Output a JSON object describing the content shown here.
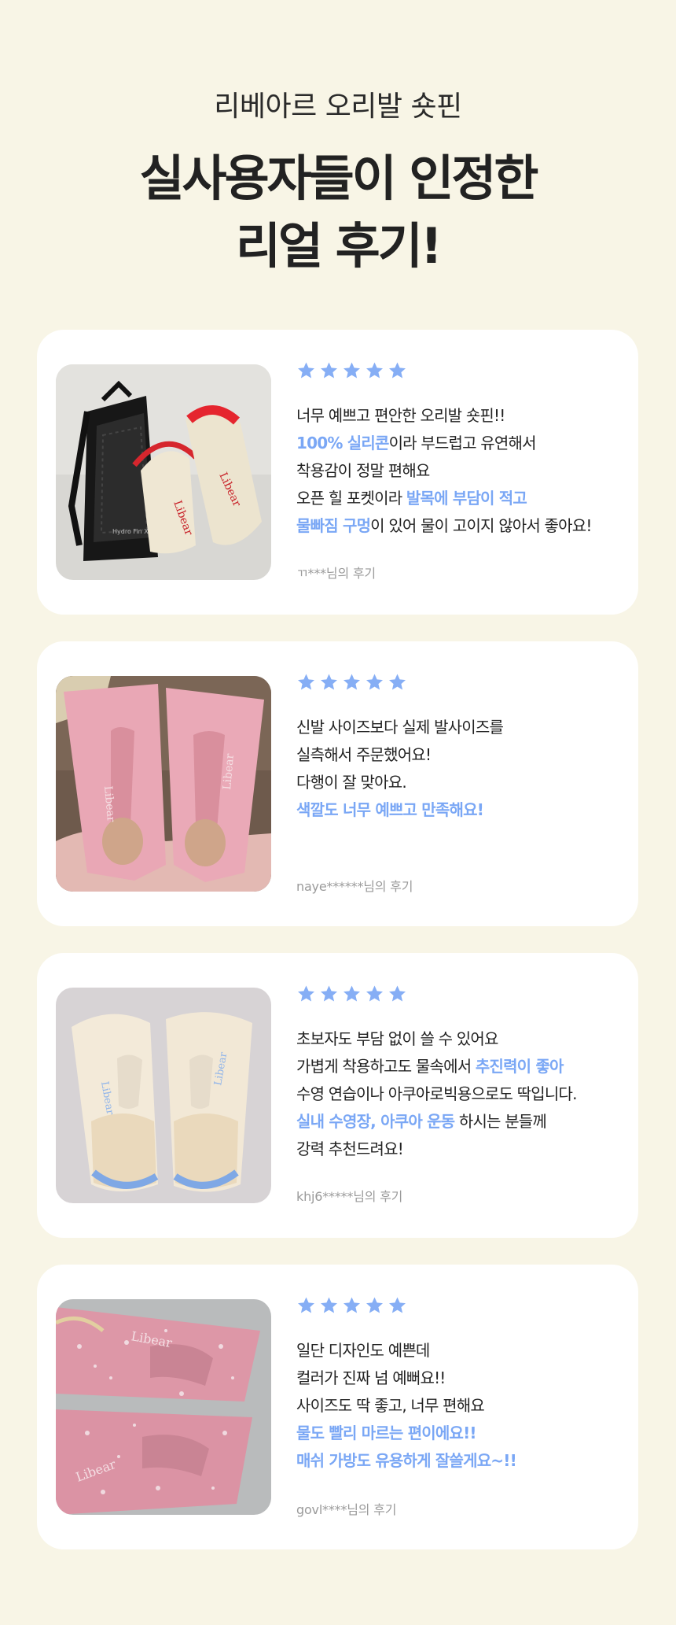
{
  "header": {
    "subtitle": "리베아르 오리발 숏핀",
    "headline_line1": "실사용자들이 인정한",
    "headline_line2": "리얼 후기!"
  },
  "colors": {
    "background": "#f8f5e6",
    "card": "#ffffff",
    "accent": "#7aa7f5",
    "text": "#222222",
    "muted": "#9a9a9a"
  },
  "star_icon": "star-icon",
  "reviews": [
    {
      "rating": 5,
      "author": "ㄲ***님의 후기",
      "photo": "black mesh bag with cream fins",
      "lines": [
        [
          {
            "text": "너무 예쁘고 편안한 오리발 숏핀!!",
            "hl": false
          }
        ],
        [
          {
            "text": "100% 실리콘",
            "hl": true
          },
          {
            "text": "이라 부드럽고 유연해서",
            "hl": false
          }
        ],
        [
          {
            "text": "착용감이 정말 편해요",
            "hl": false
          }
        ],
        [
          {
            "text": "오픈 힐 포켓이라 ",
            "hl": false
          },
          {
            "text": "발목에 부담이 적고",
            "hl": true
          }
        ],
        [
          {
            "text": "물빠짐 구멍",
            "hl": true
          },
          {
            "text": "이 있어 물이 고이지 않아서 좋아요!",
            "hl": false
          }
        ]
      ]
    },
    {
      "rating": 5,
      "author": "naye******님의 후기",
      "photo": "pink fins on feet",
      "lines": [
        [
          {
            "text": "신발 사이즈보다 실제 발사이즈를",
            "hl": false
          }
        ],
        [
          {
            "text": "실측해서 주문했어요!",
            "hl": false
          }
        ],
        [
          {
            "text": "다행이 잘 맞아요.",
            "hl": false
          }
        ],
        [
          {
            "text": "색깔도 너무 예쁘고 만족해요!",
            "hl": true
          }
        ]
      ]
    },
    {
      "rating": 5,
      "author": "khj6*****님의 후기",
      "photo": "cream fins with blue heel",
      "lines": [
        [
          {
            "text": "초보자도 부담 없이 쓸 수 있어요",
            "hl": false
          }
        ],
        [
          {
            "text": "가볍게 착용하고도 물속에서 ",
            "hl": false
          },
          {
            "text": "추진력이 좋아",
            "hl": true
          }
        ],
        [
          {
            "text": "수영 연습이나 아쿠아로빅용으로도 딱입니다.",
            "hl": false
          }
        ],
        [
          {
            "text": "실내 수영장, 아쿠아 운동",
            "hl": true
          },
          {
            "text": " 하시는 분들께",
            "hl": false
          }
        ],
        [
          {
            "text": "강력  추천드려요!",
            "hl": false
          }
        ]
      ]
    },
    {
      "rating": 5,
      "author": "govl****님의 후기",
      "photo": "wet pink fins",
      "lines": [
        [
          {
            "text": "일단 디자인도 예쁜데",
            "hl": false
          }
        ],
        [
          {
            "text": "컬러가 진짜 넘 예뻐요!!",
            "hl": false
          }
        ],
        [
          {
            "text": "사이즈도 딱 좋고, 너무 편해요",
            "hl": false
          }
        ],
        [
          {
            "text": "물도 빨리 마르는 편이에요!!",
            "hl": true
          }
        ],
        [
          {
            "text": "매쉬 가방도 유용하게 잘쓸게요~!!",
            "hl": true
          }
        ]
      ]
    }
  ]
}
